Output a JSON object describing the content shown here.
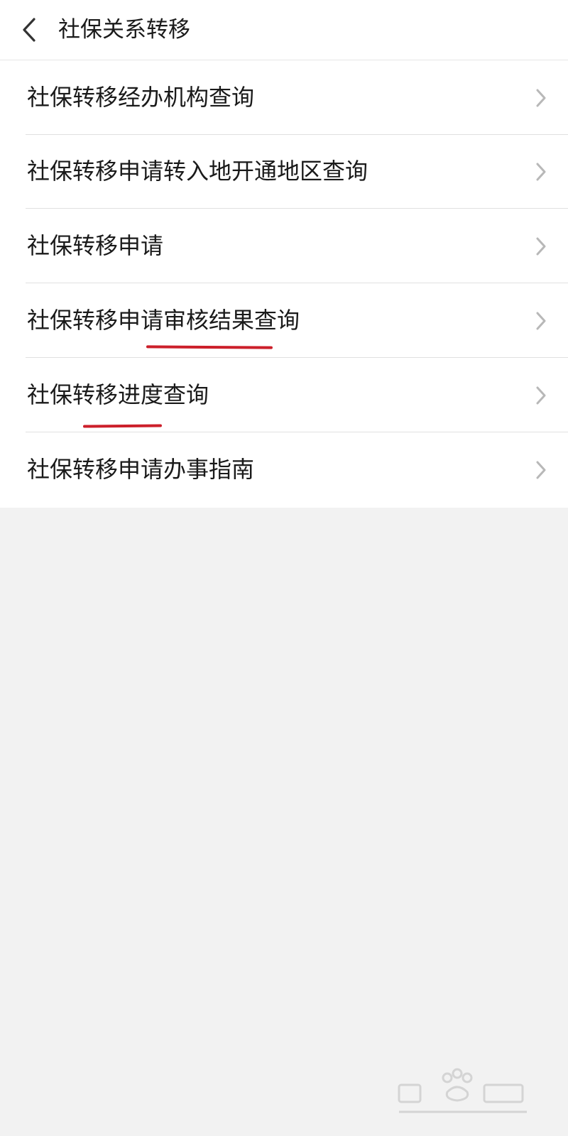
{
  "header": {
    "title": "社保关系转移",
    "back_icon": "chevron-left-icon"
  },
  "menu": {
    "items": [
      {
        "label": "社保转移经办机构查询"
      },
      {
        "label": "社保转移申请转入地开通地区查询"
      },
      {
        "label": "社保转移申请"
      },
      {
        "label": "社保转移申请审核结果查询"
      },
      {
        "label": "社保转移进度查询"
      },
      {
        "label": "社保转移申请办事指南"
      }
    ],
    "chevron_icon": "chevron-right-icon"
  },
  "colors": {
    "page_background": "#f2f2f2",
    "panel_background": "#ffffff",
    "text": "#1a1a1a",
    "chevron": "#b8b8b8",
    "annotation": "#cc1f2a"
  }
}
